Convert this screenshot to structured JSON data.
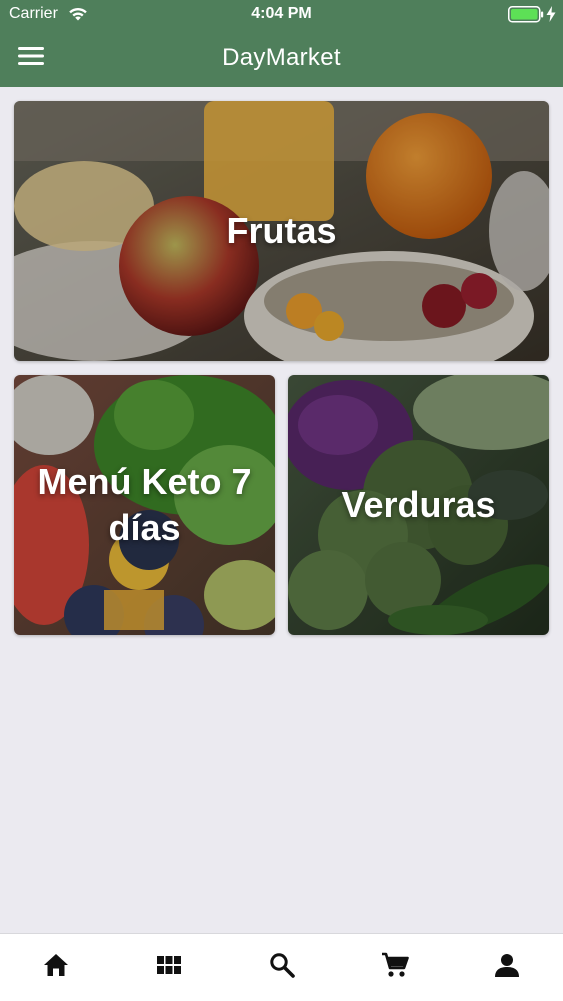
{
  "status_bar": {
    "carrier": "Carrier",
    "time": "4:04 PM"
  },
  "nav": {
    "title": "DayMarket",
    "menu_icon": "hamburger-menu-icon"
  },
  "categories": [
    {
      "label": "Frutas"
    },
    {
      "label": "Menú Keto 7 días"
    },
    {
      "label": "Verduras"
    }
  ],
  "tab_bar": {
    "icons": [
      "home-icon",
      "grid-icon",
      "search-icon",
      "cart-icon",
      "person-icon"
    ]
  },
  "colors": {
    "header": "#4f7f5b",
    "background": "#ebeaf0",
    "tab_icon": "#111111"
  }
}
